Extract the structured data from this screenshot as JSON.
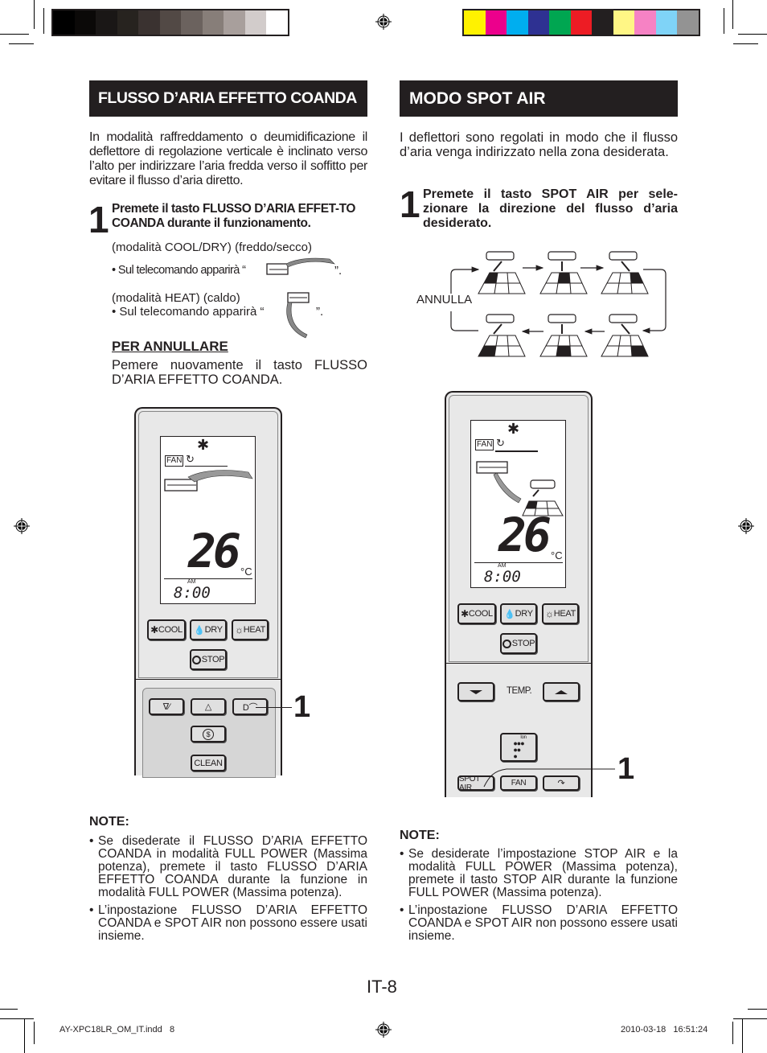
{
  "print_marks": {
    "grayscale_swatches": [
      "#000000",
      "#0b0908",
      "#1a1716",
      "#27231f",
      "#3a3230",
      "#524945",
      "#6b625e",
      "#877e79",
      "#a89f9c",
      "#d2cccb",
      "#ffffff"
    ],
    "color_swatches": [
      "#fff200",
      "#ec008c",
      "#00aeef",
      "#2e3192",
      "#00a651",
      "#ed1c24",
      "#231f20",
      "#fff685",
      "#f682c4",
      "#7fd3f7",
      "#939393"
    ]
  },
  "left": {
    "heading": "FLUSSO D’ARIA EFFETTO COANDA",
    "intro": "In modalità raffreddamento o deumidificazione il deflettore di regolazione verticale è inclinato verso l’alto per indirizzare l’aria fredda verso il soffitto per evitare il flusso d’aria diretto.",
    "step_number": "1",
    "step_text": "Premete il tasto FLUSSO D’ARIA EFFET-TO COANDA durante il funzionamento.",
    "mode_cool": "(modalità COOL/DRY) (freddo/secco)",
    "display_cool_prefix": "• Sul telecomando apparirà  “",
    "display_cool_suffix": "”.",
    "mode_heat": "(modalità HEAT) (caldo)",
    "display_heat_prefix": "• Sul telecomando apparirà  “",
    "display_heat_suffix": "”.",
    "cancel_heading": "PER ANNULLARE",
    "cancel_text": "Pemere nuovamente il tasto FLUSSO D’ARIA EFFETTO COANDA.",
    "remote": {
      "fan_label": "FAN",
      "temperature": "26",
      "unit": "°C",
      "am": "AM",
      "time": "8:00",
      "buttons": {
        "cool": "COOL",
        "dry": "DRY",
        "heat": "HEAT",
        "stop": "STOP",
        "clean": "CLEAN"
      },
      "callout": "1"
    },
    "note_heading": "NOTE:",
    "notes": [
      "Se disederate il FLUSSO D’ARIA EFFETTO COANDA in modalità FULL POWER (Massima potenza), premete il tasto FLUSSO D’ARIA EFFETTO COANDA durante la funzione in modalità FULL POWER (Massima potenza).",
      "L’inpostazione FLUSSO D’ARIA EFFETTO COANDA e SPOT AIR non possono essere usati insieme."
    ]
  },
  "right": {
    "heading": "MODO SPOT AIR",
    "intro": "I deflettori sono regolati in modo che il flusso d’aria venga indirizzato nella zona desiderata.",
    "step_number": "1",
    "step_text": "Premete il tasto SPOT AIR per sele-zionare la direzione del flusso d’aria desiderato.",
    "cycle_label": "ANNULLA",
    "cycle_positions": [
      "back-left",
      "back-center",
      "back-right",
      "front-right",
      "front-center",
      "front-left"
    ],
    "remote": {
      "fan_label": "FAN",
      "temperature": "26",
      "unit": "°C",
      "am": "AM",
      "time": "8:00",
      "buttons": {
        "cool": "COOL",
        "dry": "DRY",
        "heat": "HEAT",
        "stop": "STOP",
        "temp": "TEMP.",
        "ion": "Ion",
        "spot_air": "SPOT AIR",
        "fan": "FAN"
      },
      "callout": "1"
    },
    "note_heading": "NOTE:",
    "notes": [
      "Se desiderate l’impostazione STOP AIR e la modalità FULL POWER (Massima potenza), premete il tasto STOP AIR durante la funzione FULL POWER (Massima potenza).",
      "L’inpostazione FLUSSO D’ARIA EFFETTO COANDA e SPOT AIR non possono essere usati insieme."
    ]
  },
  "footer": {
    "page_number": "IT-8",
    "file_info": "AY-XPC18LR_OM_IT.indd   8",
    "timestamp": "2010-03-18   16:51:24"
  }
}
